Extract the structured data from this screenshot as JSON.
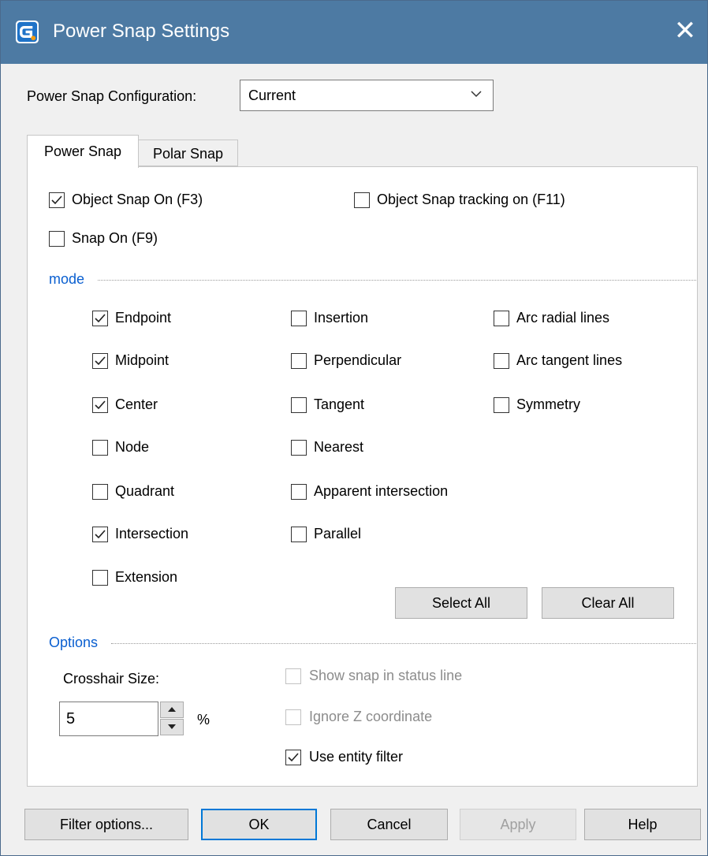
{
  "window": {
    "title": "Power Snap Settings"
  },
  "config": {
    "label": "Power Snap Configuration:",
    "value": "Current"
  },
  "tabs": [
    {
      "label": "Power Snap",
      "active": true
    },
    {
      "label": "Polar Snap",
      "active": false
    }
  ],
  "top_options": {
    "object_snap_on": {
      "label": "Object Snap On (F3)",
      "checked": true
    },
    "object_snap_tracking": {
      "label": "Object Snap tracking on (F11)",
      "checked": false
    },
    "snap_on": {
      "label": "Snap On (F9)",
      "checked": false
    }
  },
  "mode": {
    "heading": "mode",
    "col1": [
      {
        "label": "Endpoint",
        "checked": true
      },
      {
        "label": "Midpoint",
        "checked": true
      },
      {
        "label": "Center",
        "checked": true
      },
      {
        "label": "Node",
        "checked": false
      },
      {
        "label": "Quadrant",
        "checked": false
      },
      {
        "label": "Intersection",
        "checked": true
      },
      {
        "label": "Extension",
        "checked": false
      }
    ],
    "col2": [
      {
        "label": "Insertion",
        "checked": false
      },
      {
        "label": "Perpendicular",
        "checked": false
      },
      {
        "label": "Tangent",
        "checked": false
      },
      {
        "label": "Nearest",
        "checked": false
      },
      {
        "label": "Apparent intersection",
        "checked": false
      },
      {
        "label": "Parallel",
        "checked": false
      }
    ],
    "col3": [
      {
        "label": "Arc radial lines",
        "checked": false
      },
      {
        "label": "Arc tangent lines",
        "checked": false
      },
      {
        "label": "Symmetry",
        "checked": false
      }
    ],
    "select_all_label": "Select All",
    "clear_all_label": "Clear All"
  },
  "options": {
    "heading": "Options",
    "crosshair_label": "Crosshair Size:",
    "crosshair_value": "5",
    "crosshair_unit": "%",
    "show_snap": {
      "label": "Show snap in status line",
      "checked": false,
      "disabled": true
    },
    "ignore_z": {
      "label": "Ignore Z coordinate",
      "checked": false,
      "disabled": true
    },
    "use_entity_filter": {
      "label": "Use entity filter",
      "checked": true,
      "disabled": false
    }
  },
  "buttons": {
    "filter_options": "Filter options...",
    "ok": "OK",
    "cancel": "Cancel",
    "apply": "Apply",
    "help": "Help"
  },
  "colors": {
    "titlebar": "#4d7aa3",
    "section_heading": "#0a5fd0",
    "ok_focus": "#0078d7"
  },
  "icons": {
    "app": "gstarcad-app-icon",
    "close": "close-icon",
    "dropdown": "chevron-down-icon"
  }
}
